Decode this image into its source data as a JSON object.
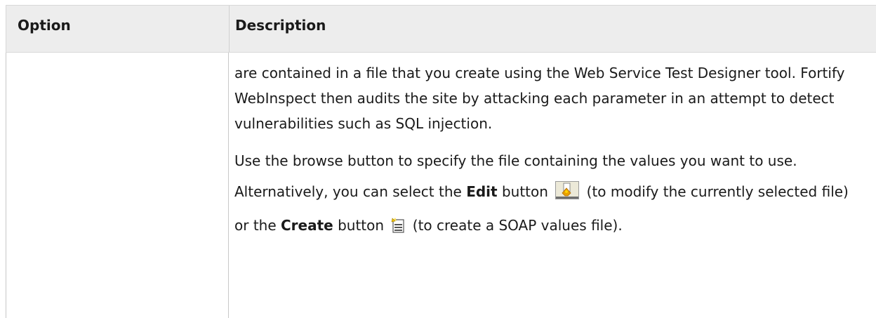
{
  "table": {
    "col_option": "Option",
    "col_description": "Description"
  },
  "description": {
    "para1": "are contained in a file that you create using the Web Service Test Designer tool. Fortify WebInspect then audits the site by attacking each parameter in an attempt to detect vulnerabilities such as SQL injection.",
    "para2_start": "Use the browse button to specify the file containing the values you want to use. Alternatively, you can select the ",
    "edit_label": "Edit",
    "para2_mid1": " button ",
    "para2_mid2": " (to modify the currently selected file) or the ",
    "create_label": "Create",
    "para2_mid3": " button ",
    "para2_end": " (to create a SOAP values file).",
    "icons": [
      "edit-icon",
      "create-icon"
    ]
  }
}
